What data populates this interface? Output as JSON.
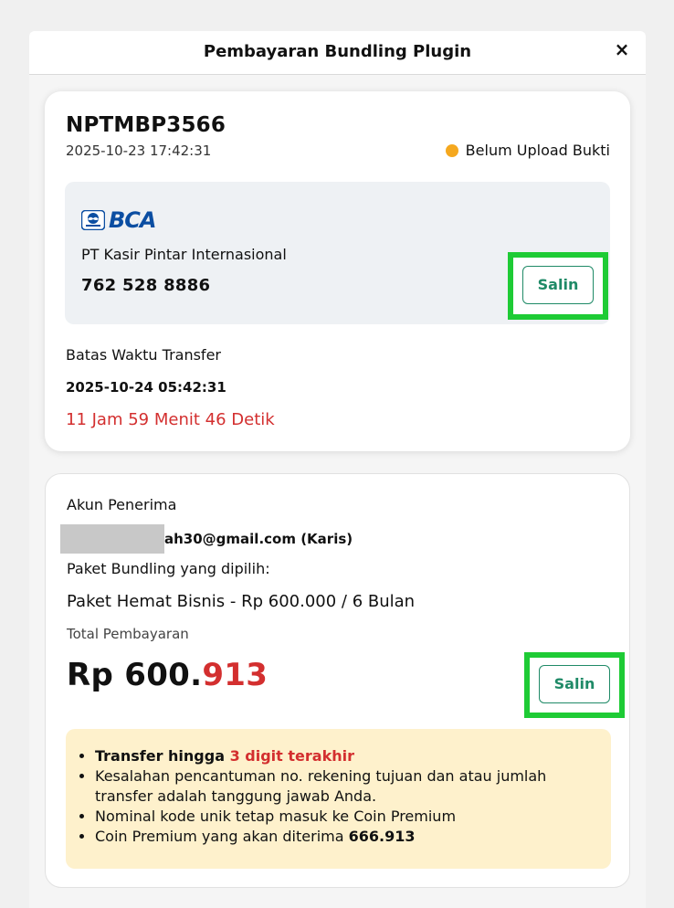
{
  "modal": {
    "title": "Pembayaran Bundling Plugin",
    "close_label": "×"
  },
  "order": {
    "id": "NPTMBP3566",
    "date": "2025-10-23 17:42:31",
    "status": "Belum Upload Bukti",
    "status_color": "#f5a81f"
  },
  "bank": {
    "logo_text": "BCA",
    "account_name": "PT Kasir Pintar Internasional",
    "account_number": "762 528 8886",
    "copy_label": "Salin"
  },
  "deadline": {
    "label": "Batas Waktu Transfer",
    "value": "2025-10-24 05:42:31",
    "countdown": "11 Jam 59 Menit 46 Detik"
  },
  "recipient": {
    "label": "Akun Penerima",
    "email_visible": "ah30@gmail.com (Karis)"
  },
  "package": {
    "label": "Paket Bundling yang dipilih:",
    "value": "Paket Hemat Bisnis - Rp 600.000 / 6 Bulan"
  },
  "total": {
    "label": "Total Pembayaran",
    "prefix": "Rp 600.",
    "unique_digits": "913",
    "copy_label": "Salin"
  },
  "notes": {
    "item1_prefix": "Transfer hingga ",
    "item1_highlight": "3 digit terakhir",
    "item2": "Kesalahan pencantuman no. rekening tujuan dan atau jumlah transfer adalah tanggung jawab Anda.",
    "item3": "Nominal kode unik tetap masuk ke Coin Premium",
    "item4_prefix": "Coin Premium yang akan diterima ",
    "item4_value": "666.913"
  },
  "colors": {
    "accent_green": "#1f8a67",
    "highlight_border": "#1ecb35",
    "danger": "#d32f2f",
    "bank_blue": "#0b4ea2"
  }
}
